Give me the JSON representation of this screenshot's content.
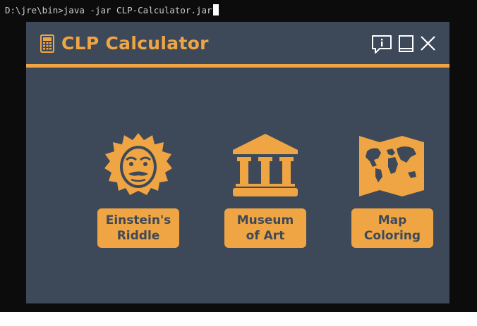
{
  "console": {
    "command": "D:\\jre\\bin>java -jar CLP-Calculator.jar"
  },
  "window": {
    "title": "CLP Calculator",
    "accent_color": "#f0a544",
    "background_color": "#3d4958",
    "controls": {
      "info_icon": "info-speech-bubble-icon",
      "minimize_icon": "minimize-icon",
      "close_icon": "close-icon"
    }
  },
  "games": [
    {
      "icon": "einstein-icon",
      "label_line1": "Einstein's",
      "label_line2": "Riddle"
    },
    {
      "icon": "museum-icon",
      "label_line1": "Museum",
      "label_line2": "of Art"
    },
    {
      "icon": "world-map-icon",
      "label_line1": "Map",
      "label_line2": "Coloring"
    }
  ]
}
